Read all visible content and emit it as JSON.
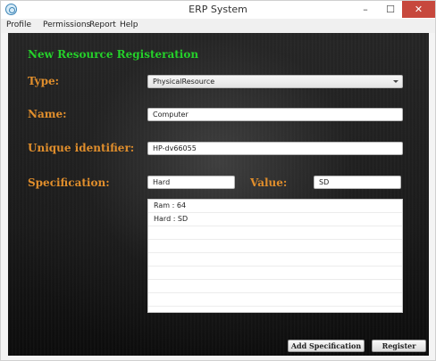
{
  "window": {
    "title": "ERP System",
    "minimize": "–",
    "maximize": "☐",
    "close": "✕"
  },
  "menu": [
    "Profile",
    "Permissions",
    "Report",
    "Help"
  ],
  "form": {
    "title": "New Resource Registeration",
    "type_label": "Type:",
    "type_value": "PhysicalResource",
    "name_label": "Name:",
    "name_value": "Computer",
    "uid_label": "Unique identifier:",
    "uid_value": "HP-dv66055",
    "spec_label": "Specification:",
    "spec_value": "Hard",
    "value_label": "Value:",
    "value_value": "SD",
    "spec_list": [
      "Ram : 64",
      "Hard : SD",
      "",
      "",
      "",
      "",
      "",
      ""
    ],
    "add_spec_button": "Add Specification",
    "register_button": "Register"
  },
  "colors": {
    "title_green": "#25d02a",
    "label_orange": "#e08e2c",
    "close_red": "#c7483d"
  }
}
